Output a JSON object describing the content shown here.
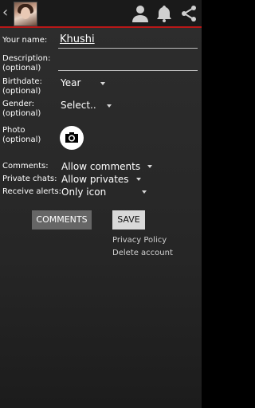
{
  "header": {
    "back_label": "‹",
    "avatar_alt": "profile-photo",
    "icons": [
      "person-icon",
      "bell-icon",
      "share-icon"
    ]
  },
  "form": {
    "name_label": "Your name:",
    "name_value": "Khushi",
    "description_label": "Description:",
    "description_sub": "(optional)",
    "birthdate_label": "Birthdate:",
    "birthdate_sub": "(optional)",
    "birthdate_value": "Year",
    "gender_label": "Gender:",
    "gender_sub": "(optional)",
    "gender_value": "Select..",
    "photo_label": "Photo",
    "photo_sub": "(optional)",
    "comments_label": "Comments:",
    "comments_value": "Allow comments",
    "private_label": "Private chats:",
    "private_value": "Allow privates",
    "alerts_label": "Receive alerts:",
    "alerts_value": "Only icon"
  },
  "actions": {
    "comments_button": "COMMENTS",
    "save_button": "SAVE",
    "privacy_link": "Privacy Policy",
    "delete_link": "Delete account"
  },
  "colors": {
    "accent": "#b81818",
    "background": "#000000"
  }
}
